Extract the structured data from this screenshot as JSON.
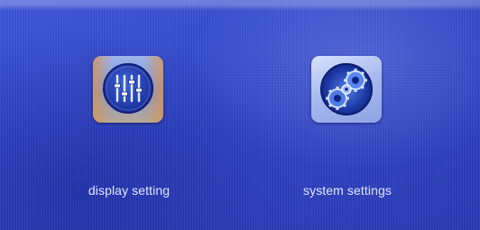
{
  "menu": {
    "items": [
      {
        "label": "display setting",
        "icon": "equalizer-sliders-icon"
      },
      {
        "label": "system settings",
        "icon": "gears-icon"
      }
    ]
  },
  "colors": {
    "background": "#3247c6",
    "label_text": "#dfe6ff",
    "icon_disc": "#1f3fb0"
  }
}
